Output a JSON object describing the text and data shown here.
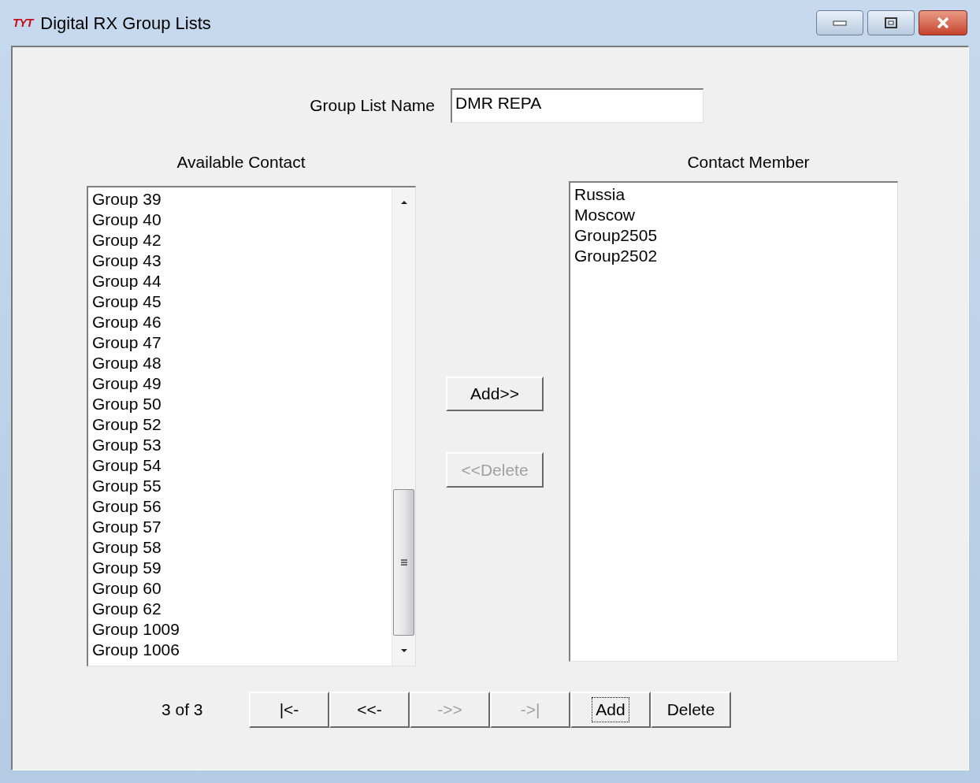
{
  "window": {
    "logo": "TYT",
    "title": "Digital RX Group Lists"
  },
  "group_list_name": {
    "label": "Group List Name",
    "value": "DMR REPA"
  },
  "available_contact": {
    "heading": "Available Contact",
    "items": [
      "Group 39",
      "Group 40",
      "Group 42",
      "Group 43",
      "Group 44",
      "Group 45",
      "Group 46",
      "Group 47",
      "Group 48",
      "Group 49",
      "Group 50",
      "Group 52",
      "Group 53",
      "Group 54",
      "Group 55",
      "Group 56",
      "Group 57",
      "Group 58",
      "Group 59",
      "Group 60",
      "Group 62",
      "Group 1009",
      "Group 1006"
    ]
  },
  "transfer_buttons": [
    {
      "label": "Add>>",
      "disabled": false
    },
    {
      "label": "<<Delete",
      "disabled": true
    }
  ],
  "contact_member": {
    "heading": "Contact Member",
    "items": [
      "Russia",
      "Moscow",
      "Group2505",
      "Group2502"
    ]
  },
  "record_position": "3 of 3",
  "nav_buttons": [
    {
      "label": "|<-",
      "disabled": false,
      "focused": false
    },
    {
      "label": "<<-",
      "disabled": false,
      "focused": false
    },
    {
      "label": "->>",
      "disabled": true,
      "focused": false
    },
    {
      "label": "->|",
      "disabled": true,
      "focused": false
    },
    {
      "label": "Add",
      "disabled": false,
      "focused": true
    },
    {
      "label": "Delete",
      "disabled": false,
      "focused": false
    }
  ]
}
